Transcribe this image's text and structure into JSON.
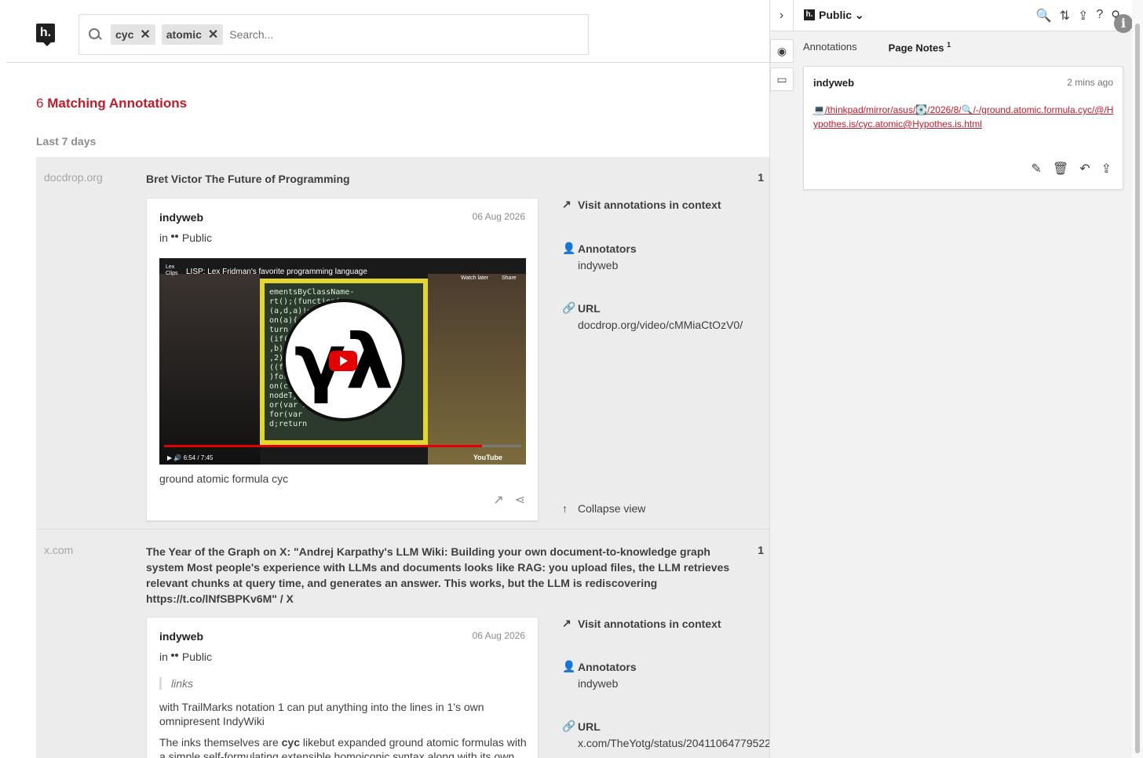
{
  "search": {
    "tags": [
      "cyc",
      "atomic"
    ],
    "remove_glyph": "✕",
    "placeholder": "Search..."
  },
  "results": {
    "count": "6",
    "label": "Matching Annotations",
    "period": "Last 7 days"
  },
  "buckets": [
    {
      "domain": "docdrop.org",
      "title": "Bret Victor The Future of Programming",
      "count": "1",
      "annotation": {
        "user": "indyweb",
        "date": "06 Aug 2026",
        "group_prefix": "in",
        "group": "Public",
        "video": {
          "title": "LISP: Lex Fridman's favorite programming language",
          "channel": "Lex Clips",
          "watch_later": "Watch later",
          "share": "Share",
          "time": "6:54 / 7:45",
          "progress": 0.89,
          "brand": "YouTube"
        },
        "text": "ground atomic formula cyc"
      },
      "side": {
        "visit": "Visit annotations in context",
        "annotators_label": "Annotators",
        "annotators_value": "indyweb",
        "url_label": "URL",
        "url_value": "docdrop.org/video/cMMiaCtOzV0/",
        "collapse": "Collapse view"
      }
    },
    {
      "domain": "x.com",
      "title": "The Year of the Graph on X: \"Andrej Karpathy's LLM Wiki: Building your own document-to-knowledge graph system Most people's experience with LLMs and documents looks like RAG: you upload files, the LLM retrieves relevant chunks at query time, and generates an answer. This works, but the LLM is rediscovering https://t.co/lNfSBPKv6M\" / X",
      "count": "1",
      "annotation": {
        "user": "indyweb",
        "date": "06 Aug 2026",
        "group_prefix": "in",
        "group": "Public",
        "quote": "links",
        "text1": "with TrailMarks notation 1 can put anything into the lines in 1's own omnipresent IndyWiki",
        "text2_pre": "The inks themselves are ",
        "text2_bold": "cyc",
        "text2_post": " likebut expanded ground atomic formulas with a simple self-formulating extensible homoiconic syntax along with its own"
      },
      "side": {
        "visit": "Visit annotations in context",
        "annotators_label": "Annotators",
        "annotators_value": "indyweb",
        "url_label": "URL",
        "url_value": "x.com/TheYotg/status/20411064779522"
      }
    }
  ],
  "sidebar": {
    "group": "Public",
    "tabs": {
      "annotations": "Annotations",
      "page_notes": "Page Notes",
      "page_notes_count": "1"
    },
    "note": {
      "user": "indyweb",
      "time": "2 mins ago",
      "link": "💻/thinkpad/mirror/asus/💽/2026/8/🔍/-/ground.atomic.formula.cyc/@/Hypothes.is/cyc.atomic@Hypothes.is.html"
    }
  },
  "icons": {
    "logo": "h.",
    "sidebar_toggle": "chevron-right-icon",
    "eye": "eye-icon",
    "note": "note-icon",
    "info": "info-icon"
  },
  "colors": {
    "brand_red": "#bd1c2b",
    "bucket_bg": "#ececec",
    "sidebar_bg": "#f2f2f2"
  }
}
